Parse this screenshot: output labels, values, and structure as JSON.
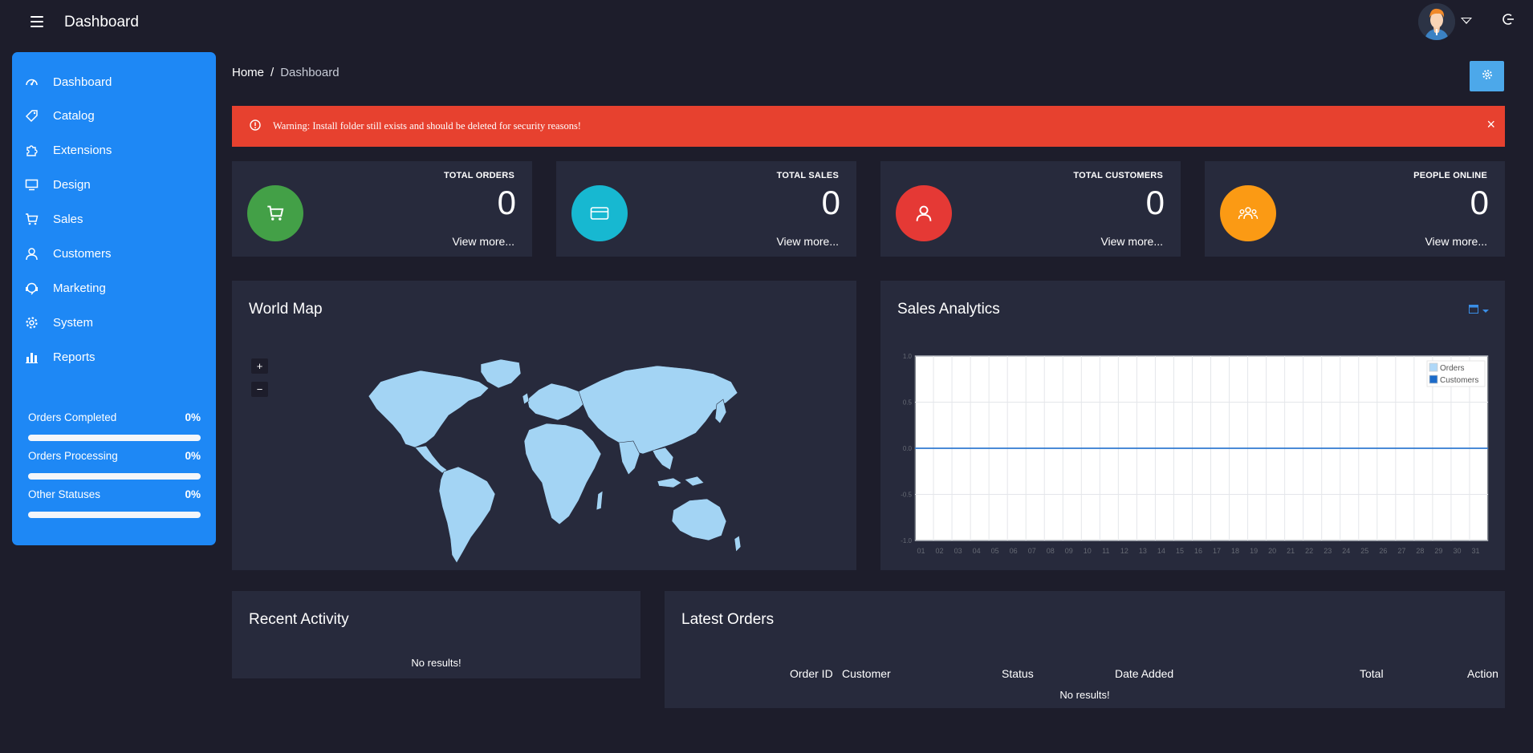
{
  "header": {
    "title": "Dashboard"
  },
  "sidebar": {
    "items": [
      {
        "label": "Dashboard",
        "icon": "dashboard-icon"
      },
      {
        "label": "Catalog",
        "icon": "tag-icon"
      },
      {
        "label": "Extensions",
        "icon": "puzzle-icon"
      },
      {
        "label": "Design",
        "icon": "monitor-icon"
      },
      {
        "label": "Sales",
        "icon": "cart-icon"
      },
      {
        "label": "Customers",
        "icon": "user-icon"
      },
      {
        "label": "Marketing",
        "icon": "megaphone-icon"
      },
      {
        "label": "System",
        "icon": "gear-icon"
      },
      {
        "label": "Reports",
        "icon": "bar-chart-icon"
      }
    ],
    "statuses": [
      {
        "label": "Orders Completed",
        "value": "0%"
      },
      {
        "label": "Orders Processing",
        "value": "0%"
      },
      {
        "label": "Other Statuses",
        "value": "0%"
      }
    ]
  },
  "breadcrumb": {
    "home": "Home",
    "separator": "/",
    "current": "Dashboard"
  },
  "alert": {
    "text": "Warning: Install folder still exists and should be deleted for security reasons!",
    "close": "×"
  },
  "stats": [
    {
      "title": "TOTAL ORDERS",
      "value": "0",
      "more": "View more...",
      "color": "#43a047",
      "icon": "cart-icon"
    },
    {
      "title": "TOTAL SALES",
      "value": "0",
      "more": "View more...",
      "color": "#17b8d1",
      "icon": "credit-card-icon"
    },
    {
      "title": "TOTAL CUSTOMERS",
      "value": "0",
      "more": "View more...",
      "color": "#e53935",
      "icon": "user-icon"
    },
    {
      "title": "PEOPLE ONLINE",
      "value": "0",
      "more": "View more...",
      "color": "#fb9a14",
      "icon": "users-icon"
    }
  ],
  "world_map": {
    "title": "World Map",
    "zoom_in": "+",
    "zoom_out": "−"
  },
  "sales_analytics": {
    "title": "Sales Analytics"
  },
  "chart_data": {
    "type": "line",
    "x": [
      "01",
      "02",
      "03",
      "04",
      "05",
      "06",
      "07",
      "08",
      "09",
      "10",
      "11",
      "12",
      "13",
      "14",
      "15",
      "16",
      "17",
      "18",
      "19",
      "20",
      "21",
      "22",
      "23",
      "24",
      "25",
      "26",
      "27",
      "28",
      "29",
      "30",
      "31"
    ],
    "series": [
      {
        "name": "Orders",
        "values": [
          0,
          0,
          0,
          0,
          0,
          0,
          0,
          0,
          0,
          0,
          0,
          0,
          0,
          0,
          0,
          0,
          0,
          0,
          0,
          0,
          0,
          0,
          0,
          0,
          0,
          0,
          0,
          0,
          0,
          0,
          0
        ]
      },
      {
        "name": "Customers",
        "values": [
          0,
          0,
          0,
          0,
          0,
          0,
          0,
          0,
          0,
          0,
          0,
          0,
          0,
          0,
          0,
          0,
          0,
          0,
          0,
          0,
          0,
          0,
          0,
          0,
          0,
          0,
          0,
          0,
          0,
          0,
          0
        ]
      }
    ],
    "yticks": [
      "1.0",
      "0.5",
      "0.0",
      "-0.5",
      "-1.0"
    ],
    "ylim": [
      -1,
      1
    ],
    "legend": "top-right",
    "colors": {
      "Orders": "#afd8f8",
      "Customers": "#1c6bc9"
    },
    "grid": true
  },
  "recent_activity": {
    "title": "Recent Activity",
    "empty": "No results!"
  },
  "latest_orders": {
    "title": "Latest Orders",
    "columns": [
      "Order ID",
      "Customer",
      "Status",
      "Date Added",
      "Total",
      "Action"
    ],
    "empty": "No results!"
  }
}
